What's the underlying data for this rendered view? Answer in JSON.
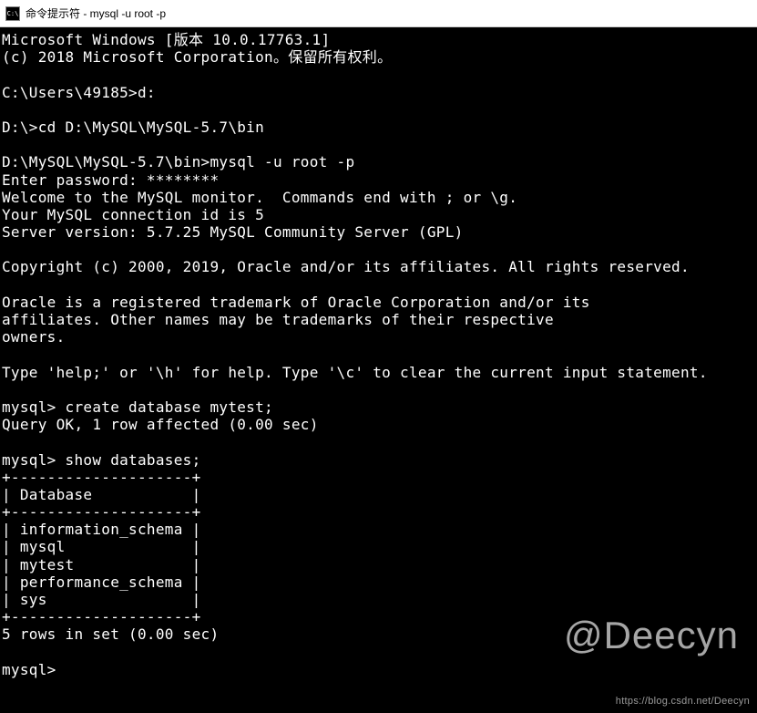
{
  "title_bar": {
    "icon_label": "C:\\",
    "title": "命令提示符 - mysql  -u root -p"
  },
  "terminal": {
    "lines": {
      "l0": "Microsoft Windows [版本 10.0.17763.1]",
      "l1": "(c) 2018 Microsoft Corporation。保留所有权利。",
      "l2": "",
      "l3": "C:\\Users\\49185>d:",
      "l4": "",
      "l5": "D:\\>cd D:\\MySQL\\MySQL-5.7\\bin",
      "l6": "",
      "l7": "D:\\MySQL\\MySQL-5.7\\bin>mysql -u root -p",
      "l8": "Enter password: ********",
      "l9": "Welcome to the MySQL monitor.  Commands end with ; or \\g.",
      "l10": "Your MySQL connection id is 5",
      "l11": "Server version: 5.7.25 MySQL Community Server (GPL)",
      "l12": "",
      "l13": "Copyright (c) 2000, 2019, Oracle and/or its affiliates. All rights reserved.",
      "l14": "",
      "l15": "Oracle is a registered trademark of Oracle Corporation and/or its",
      "l16": "affiliates. Other names may be trademarks of their respective",
      "l17": "owners.",
      "l18": "",
      "l19": "Type 'help;' or '\\h' for help. Type '\\c' to clear the current input statement.",
      "l20": "",
      "l21": "mysql> create database mytest;",
      "l22": "Query OK, 1 row affected (0.00 sec)",
      "l23": "",
      "l24": "mysql> show databases;",
      "l25": "+--------------------+",
      "l26": "| Database           |",
      "l27": "+--------------------+",
      "l28": "| information_schema |",
      "l29": "| mysql              |",
      "l30": "| mytest             |",
      "l31": "| performance_schema |",
      "l32": "| sys                |",
      "l33": "+--------------------+",
      "l34": "5 rows in set (0.00 sec)",
      "l35": "",
      "l36": "mysql>"
    }
  },
  "watermark": "@Deecyn",
  "footer_url": "https://blog.csdn.net/Deecyn"
}
